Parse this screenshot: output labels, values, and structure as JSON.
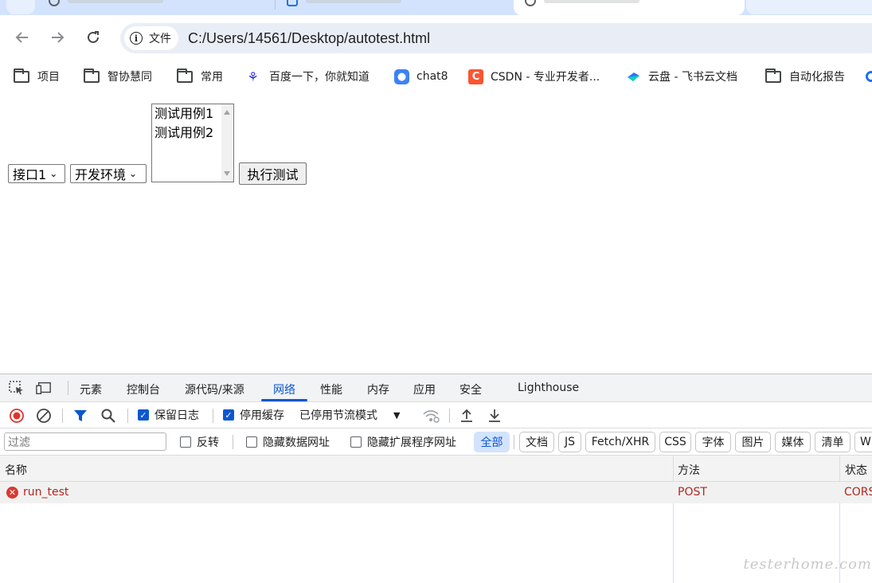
{
  "browser": {
    "address": {
      "chip_label": "文件",
      "url": "C:/Users/14561/Desktop/autotest.html"
    },
    "bookmarks": [
      {
        "label": "项目",
        "icon": "folder-icon"
      },
      {
        "label": "智协慧同",
        "icon": "folder-icon"
      },
      {
        "label": "常用",
        "icon": "folder-icon"
      },
      {
        "label": "百度一下，你就知道",
        "icon": "baidu-icon"
      },
      {
        "label": "chat8",
        "icon": "chat-icon"
      },
      {
        "label": "CSDN - 专业开发者...",
        "icon": "csdn-icon"
      },
      {
        "label": "云盘 - 飞书云文档",
        "icon": "feishu-icon"
      },
      {
        "label": "自动化报告",
        "icon": "folder-icon"
      }
    ]
  },
  "page": {
    "api_select": "接口1",
    "env_select": "开发环境",
    "testcases": [
      "测试用例1",
      "测试用例2"
    ],
    "run_button": "执行测试"
  },
  "devtools": {
    "tabs": [
      "元素",
      "控制台",
      "源代码/来源",
      "网络",
      "性能",
      "内存",
      "应用",
      "安全",
      "Lighthouse"
    ],
    "active_tab": "网络",
    "toolbar": {
      "preserve_log": "保留日志",
      "disable_cache": "停用缓存",
      "throttling": "已停用节流模式"
    },
    "filter": {
      "placeholder": "过滤",
      "invert": "反转",
      "hide_data_urls": "隐藏数据网址",
      "hide_extension_urls": "隐藏扩展程序网址",
      "types": [
        "全部",
        "文档",
        "JS",
        "Fetch/XHR",
        "CSS",
        "字体",
        "图片",
        "媒体",
        "清单",
        "W"
      ]
    },
    "columns": [
      "名称",
      "方法",
      "状态"
    ],
    "rows": [
      {
        "name": "run_test",
        "method": "POST",
        "status": "CORS"
      }
    ]
  },
  "watermark": "testerhome.com",
  "colors": {
    "accent": "#0b57d0",
    "error": "#b3261e",
    "tab_strip": "#d3e3fd"
  }
}
